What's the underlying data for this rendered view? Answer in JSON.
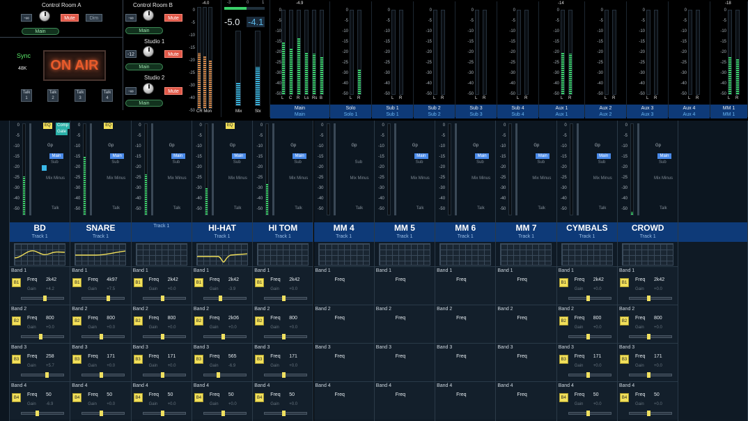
{
  "monitor": {
    "crA": {
      "title": "Control Room A",
      "minus_label": "-∞",
      "mute_label": "Mute",
      "dim_label": "Dim",
      "source_label": "Main"
    },
    "crB": {
      "title": "Control Room B",
      "minus_label": "-∞",
      "mute_label": "Mute",
      "source_label": "Main"
    },
    "studio1": {
      "title": "Studio 1",
      "minus_label": "-12",
      "mute_label": "Mute",
      "source_label": "Main"
    },
    "studio2": {
      "title": "Studio 2",
      "minus_label": "-∞",
      "mute_label": "Mute",
      "source_label": "Main"
    },
    "sync": {
      "label": "Sync",
      "rate": "48K"
    },
    "on_air": "ON AIR",
    "talk": [
      {
        "l1": "Talk",
        "l2": "1"
      },
      {
        "l1": "Talk",
        "l2": "2"
      },
      {
        "l1": "Talk",
        "l2": "3"
      },
      {
        "l1": "Talk",
        "l2": "4"
      }
    ]
  },
  "mon_meters": {
    "cr_peak": "-4.0",
    "cr_label": "CR Mon",
    "scale": [
      "0",
      "-5",
      "-10",
      "-15",
      "-20",
      "-25",
      "-30",
      "-40",
      "-50"
    ],
    "mix_readout_l": "-5.0",
    "mix_readout_r": "-4.1",
    "mix_scale": [
      "-3",
      "0",
      "1"
    ],
    "mix_label": "Mix",
    "stx_label": "Stx"
  },
  "buses": [
    {
      "top": "Main",
      "bot": "Main",
      "peak": "-4.9",
      "levels": [
        0.62,
        0.55,
        0.67,
        0.5,
        0.48,
        0.45
      ],
      "ch": [
        "L",
        "C",
        "R",
        "Ls",
        "Rs",
        "B"
      ]
    },
    {
      "top": "Solo",
      "bot": "Solo 1",
      "peak": "",
      "levels": [
        0,
        0.3
      ],
      "ch": [
        "L",
        "R"
      ]
    },
    {
      "top": "Sub 1",
      "bot": "Sub 1",
      "peak": "",
      "levels": [
        0,
        0
      ],
      "ch": [
        "L",
        "R"
      ]
    },
    {
      "top": "Sub 2",
      "bot": "Sub 2",
      "peak": "",
      "levels": [
        0,
        0
      ],
      "ch": [
        "L",
        "R"
      ]
    },
    {
      "top": "Sub 3",
      "bot": "Sub 3",
      "peak": "",
      "levels": [
        0,
        0
      ],
      "ch": [
        "L",
        "R"
      ]
    },
    {
      "top": "Sub 4",
      "bot": "Sub 4",
      "peak": "",
      "levels": [
        0,
        0
      ],
      "ch": [
        "L",
        "R"
      ]
    },
    {
      "top": "Aux 1",
      "bot": "Aux 1",
      "peak": "-14",
      "levels": [
        0.5,
        0.48
      ],
      "ch": [
        "L",
        "R"
      ]
    },
    {
      "top": "Aux 2",
      "bot": "Aux 2",
      "peak": "",
      "levels": [
        0,
        0
      ],
      "ch": [
        "L",
        "R"
      ]
    },
    {
      "top": "Aux 3",
      "bot": "Aux 3",
      "peak": "",
      "levels": [
        0,
        0
      ],
      "ch": [
        "L",
        "R"
      ]
    },
    {
      "top": "Aux 4",
      "bot": "Aux 4",
      "peak": "",
      "levels": [
        0,
        0
      ],
      "ch": [
        "L",
        "R"
      ]
    },
    {
      "top": "MM 1",
      "bot": "MM 1",
      "peak": "-18",
      "levels": [
        0.45,
        0.42
      ],
      "ch": [
        "L",
        "R"
      ]
    }
  ],
  "bus_scale": [
    "0",
    "-5",
    "-10",
    "-15",
    "-20",
    "-25",
    "-30",
    "-40",
    "-50"
  ],
  "strip_scale": [
    "0",
    "-5",
    "-10",
    "-15",
    "-20",
    "-25",
    "-30",
    "-40",
    "-50"
  ],
  "strip_labels": {
    "gp": "Gp",
    "main": "Main",
    "sub": "Sub",
    "mixminus": "Mix Minus",
    "talk": "Talk"
  },
  "channels": [
    {
      "name": "BD",
      "track": "Track 1",
      "level": 0.42,
      "eq": true,
      "comp": true,
      "eq_label": "EQ",
      "comp_label": "Comp",
      "gate_label": "Gate",
      "blue": true,
      "curve": "bd",
      "bands": [
        {
          "f": "2k42",
          "g": "+4.2",
          "k": 0.55
        },
        {
          "f": "800",
          "g": "+0.0",
          "k": 0.45
        },
        {
          "f": "258",
          "g": "+5.7",
          "k": 0.6
        },
        {
          "f": "50",
          "g": "-6.9",
          "k": 0.35
        }
      ]
    },
    {
      "name": "SNARE",
      "track": "Track 1",
      "level": 0.65,
      "eq": true,
      "eq_label": "EQ",
      "curve": "snare",
      "bands": [
        {
          "f": "4k97",
          "g": "+7.5",
          "k": 0.62
        },
        {
          "f": "800",
          "g": "+0.0",
          "k": 0.45
        },
        {
          "f": "171",
          "g": "+0.0",
          "k": 0.45
        },
        {
          "f": "50",
          "g": "+0.0",
          "k": 0.45
        }
      ]
    },
    {
      "name": "",
      "track": "Track 1",
      "level": 0.45,
      "curve": "flat",
      "bands": [
        {
          "f": "2k42",
          "g": "+0.0",
          "k": 0.45
        },
        {
          "f": "800",
          "g": "+0.0",
          "k": 0.45
        },
        {
          "f": "171",
          "g": "+0.0",
          "k": 0.45
        },
        {
          "f": "50",
          "g": "+0.0",
          "k": 0.45
        }
      ]
    },
    {
      "name": "HI-HAT",
      "track": "Track 1",
      "level": 0.3,
      "eq": true,
      "eq_label": "EQ",
      "curve": "hihat",
      "bands": [
        {
          "f": "2k42",
          "g": "-3.9",
          "k": 0.38
        },
        {
          "f": "2k06",
          "g": "+0.0",
          "k": 0.45
        },
        {
          "f": "565",
          "g": "-6.9",
          "k": 0.32
        },
        {
          "f": "50",
          "g": "+0.0",
          "k": 0.45
        }
      ]
    },
    {
      "name": "HI TOM",
      "track": "Track 1",
      "level": 0.35,
      "curve": "flat",
      "bands": [
        {
          "f": "2k42",
          "g": "+0.0",
          "k": 0.45
        },
        {
          "f": "800",
          "g": "+0.0",
          "k": 0.45
        },
        {
          "f": "171",
          "g": "+0.0",
          "k": 0.45
        },
        {
          "f": "50",
          "g": "+0.0",
          "k": 0.45
        }
      ]
    },
    {
      "name": "MM 4",
      "track": "Track 1",
      "level": 0,
      "curve": "flat",
      "empty": true
    },
    {
      "name": "MM 5",
      "track": "Track 1",
      "level": 0,
      "curve": "flat",
      "empty": true
    },
    {
      "name": "MM 6",
      "track": "Track 1",
      "level": 0,
      "curve": "flat",
      "empty": true
    },
    {
      "name": "MM 7",
      "track": "Track 1",
      "level": 0,
      "curve": "flat",
      "empty": true
    },
    {
      "name": "CYMBALS",
      "track": "Track 1",
      "level": 0,
      "curve": "flat",
      "bands": [
        {
          "f": "2k42",
          "g": "+0.0",
          "k": 0.45
        },
        {
          "f": "800",
          "g": "+0.0",
          "k": 0.45
        },
        {
          "f": "171",
          "g": "+0.0",
          "k": 0.45
        },
        {
          "f": "50",
          "g": "+0.0",
          "k": 0.45
        }
      ]
    },
    {
      "name": "CROWD",
      "track": "Track 1",
      "level": 0.03,
      "curve": "flat",
      "bands": [
        {
          "f": "2k42",
          "g": "+0.0",
          "k": 0.45
        },
        {
          "f": "800",
          "g": "+0.0",
          "k": 0.45
        },
        {
          "f": "171",
          "g": "+0.0",
          "k": 0.45
        },
        {
          "f": "50",
          "g": "+0.0",
          "k": 0.45
        }
      ]
    }
  ],
  "band_labels": [
    "Band 1",
    "Band 2",
    "Band 3",
    "Band 4"
  ],
  "band_btns": [
    "B1",
    "B2",
    "B3",
    "B4"
  ],
  "freq_label": "Freq",
  "gain_label": "Gain",
  "colors": {
    "on_air": "#e85a2a",
    "main_badge": "#4a8ae8",
    "band_btn": "#f2e05a",
    "mute": "#e05848",
    "meter_green": "#3ad06a",
    "meter_cyan": "#3ab0d8"
  }
}
